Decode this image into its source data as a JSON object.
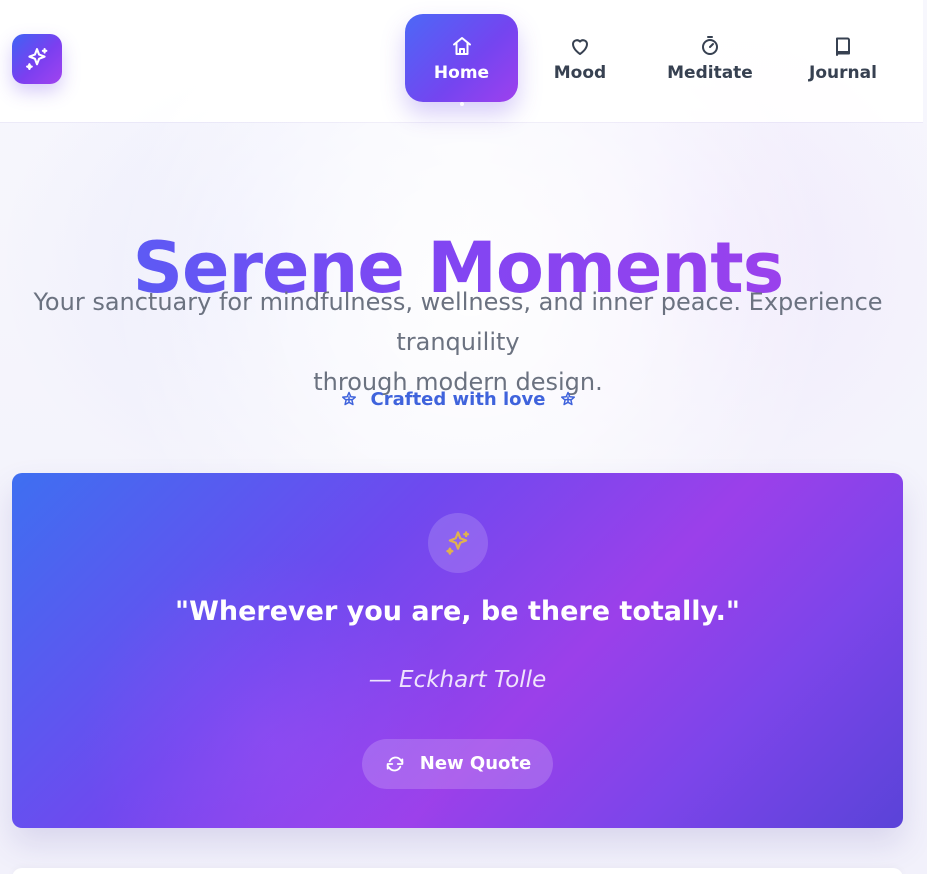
{
  "brand": {
    "logo_icon": "sparkles-icon"
  },
  "nav": {
    "items": [
      {
        "label": "Home",
        "icon": "home-icon",
        "active": true
      },
      {
        "label": "Mood",
        "icon": "heart-icon",
        "active": false
      },
      {
        "label": "Meditate",
        "icon": "timer-icon",
        "active": false
      },
      {
        "label": "Journal",
        "icon": "book-icon",
        "active": false
      }
    ]
  },
  "hero": {
    "title": "Serene Moments",
    "subtitle_line_1": "Your sanctuary for mindfulness, wellness, and inner peace. Experience tranquility",
    "subtitle_line_2": "through modern design.",
    "crafted_text": "Crafted with love",
    "crafted_icon": "star-icon"
  },
  "quote_card": {
    "icon": "sparkles-icon",
    "quote": "\"Wherever you are, be there totally.\"",
    "author": "— Eckhart Tolle",
    "button_label": "New Quote",
    "button_icon": "refresh-icon"
  },
  "colors": {
    "accent_blue": "#4c68f7",
    "accent_purple": "#9e40ee",
    "text_muted": "#6b7280",
    "link_blue": "#3f63dc"
  }
}
